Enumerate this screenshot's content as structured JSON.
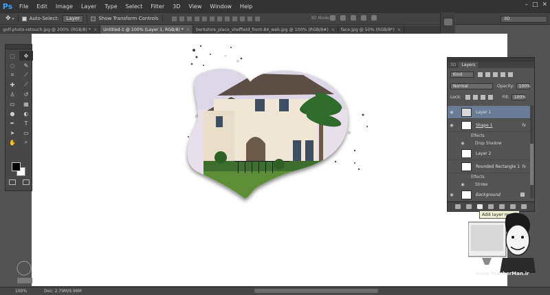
{
  "menu": {
    "logo": "Ps",
    "items": [
      "File",
      "Edit",
      "Image",
      "Layer",
      "Type",
      "Select",
      "Filter",
      "3D",
      "View",
      "Window",
      "Help"
    ],
    "window_controls": [
      "–",
      "□",
      "✕"
    ]
  },
  "options": {
    "auto_select_label": "Auto-Select:",
    "auto_select_value": "Layer",
    "show_transform_label": "Show Transform Controls",
    "mode_3d_label": "3D Mode:",
    "workspace_value": "3D"
  },
  "tabs": [
    {
      "label": "golf-photo-retouch.jpg @ 200% (RGB/8) *",
      "active": false
    },
    {
      "label": "Untitled-1 @ 100% (Layer 1, RGB/8) *",
      "active": true
    },
    {
      "label": "berkshire_place_sheffield_front-84_web.jpg @ 100% (RGB/8#)",
      "active": false
    },
    {
      "label": "face.jpg @ 50% (RGB/8*)",
      "active": false
    }
  ],
  "layers_panel": {
    "tabs": [
      "3D",
      "Layers"
    ],
    "filter_kind": "Kind",
    "blend_mode": "Normal",
    "opacity_label": "Opacity:",
    "opacity_value": "100%",
    "lock_label": "Lock:",
    "fill_label": "Fill:",
    "fill_value": "100%",
    "layers": [
      {
        "name": "Layer 1",
        "selected": true,
        "fx": false
      },
      {
        "name": "Shape 1",
        "selected": false,
        "fx": true
      },
      {
        "name": "Layer 2",
        "selected": false,
        "fx": false
      },
      {
        "name": "Rounded Rectangle 1",
        "selected": false,
        "fx": true
      },
      {
        "name": "Background",
        "selected": false,
        "fx": false
      }
    ],
    "shape_effects_label": "Effects",
    "shape_effect_item": "Drop Shadow",
    "rect_effects_label": "Effects",
    "rect_effect_item": "Stroke"
  },
  "tooltip": "Add layer mask",
  "status": {
    "zoom": "100%",
    "doc": "Doc: 2.79M/9.99M"
  },
  "watermark": {
    "site": "www.TeacherMan.ir"
  },
  "colors": {
    "accent": "#31a8ff",
    "selected_layer": "#6a7b95"
  }
}
